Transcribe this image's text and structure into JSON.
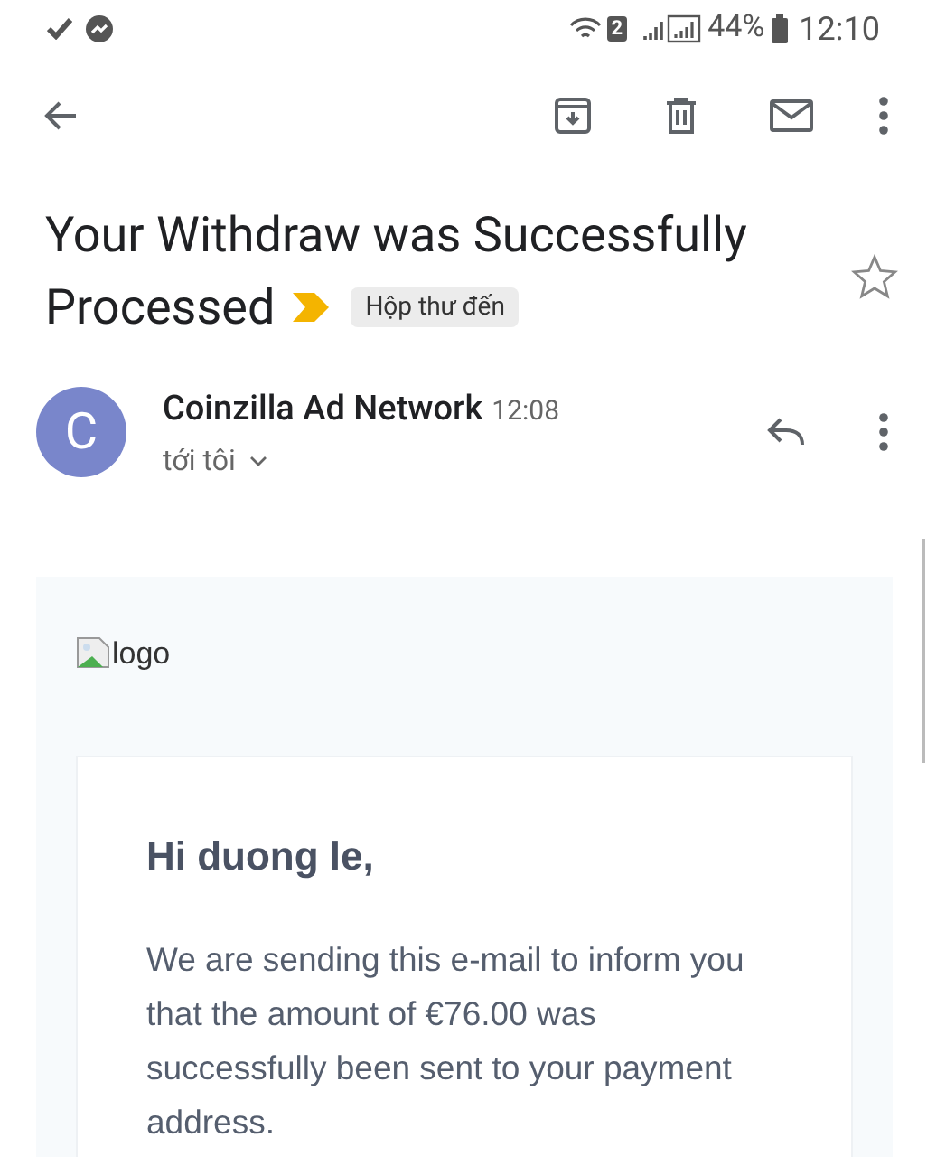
{
  "status_bar": {
    "sim_badge": "2",
    "battery": "44%",
    "time": "12:10"
  },
  "email": {
    "subject_lines": [
      "Your Withdraw was Successfully",
      "Processed"
    ],
    "important": true,
    "label": "Hộp thư đến",
    "starred": false,
    "sender": {
      "initial": "C",
      "name": "Coinzilla Ad Network",
      "time": "12:08",
      "recipient": "tới tôi"
    },
    "body": {
      "logo_alt": "logo",
      "greeting": "Hi duong le,",
      "message": "We are sending this e-mail to inform you that the amount of €76.00 was successfully been sent to your payment address."
    }
  }
}
